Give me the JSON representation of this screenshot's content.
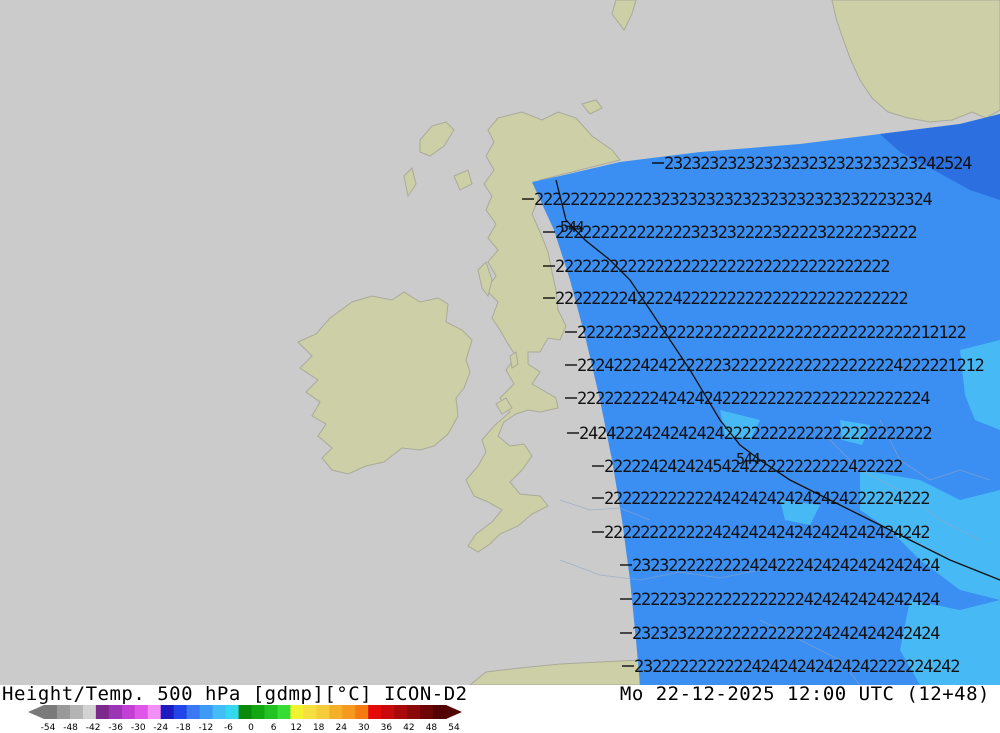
{
  "header": {
    "title": "Height/Temp. 500 hPa [gdmp][°C] ICON-D2",
    "datetime": "Mo 22-12-2025 12:00 UTC (12+48)"
  },
  "legend": {
    "ticks": [
      "-54",
      "-48",
      "-42",
      "-36",
      "-30",
      "-24",
      "-18",
      "-12",
      "-6",
      "0",
      "6",
      "12",
      "18",
      "24",
      "30",
      "36",
      "42",
      "48",
      "54"
    ],
    "colors": [
      "#7a7a7a",
      "#999999",
      "#b4b4b4",
      "#d2d2d2",
      "#7b2a8c",
      "#9a35b3",
      "#c23fd6",
      "#e056e6",
      "#f390f5",
      "#1b1bbf",
      "#2244e8",
      "#3b79f2",
      "#3e9af7",
      "#42bdf7",
      "#38d7f0",
      "#0a8a0a",
      "#12a612",
      "#21c221",
      "#35dd35",
      "#f2f230",
      "#f5e040",
      "#f5cc3a",
      "#f5b02a",
      "#f59a1e",
      "#f57a12",
      "#e50a0a",
      "#c80a0a",
      "#a80a0a",
      "#8a0a0a",
      "#6e0505",
      "#520303"
    ],
    "colors_note": ""
  },
  "map": {
    "colors": {
      "sea": "#cbcbcb",
      "land": "#cdcfa6",
      "coast": "#a9aa9a",
      "field_main": "#3b8ef2",
      "field_light": "#47baf5",
      "field_dark": "#2c6fe0"
    },
    "contour_labels": {
      "row1": "2323232323232323232323232323242524",
      "row2": "22222222222223232323232323232323232322232324",
      "row3": "2222222222222223232322223222232222232222",
      "row4": "2222222222222222222222222222222222222",
      "row5": "222222224222242222222222222222222222222",
      "row6": "2222223222222222222222222222222222222212122",
      "row7": "222422242422222232222222222222222224222221212",
      "row8": "222222222424242422222222222222222222224",
      "row9": "242422242424242422222222222222222222222",
      "row10": "222224242424542422222222222422222",
      "row11": "222222222222424242424242424222224222",
      "row12": "222222222222424242424242424242424242",
      "row13": "2323222222222424222424242424242424",
      "row14": "2222232222222222222424242424242424",
      "row15": "2323232222222222222224242424242424",
      "row16": "232222222222242424242424242222224242",
      "marker1": "544",
      "marker2": "544"
    }
  }
}
